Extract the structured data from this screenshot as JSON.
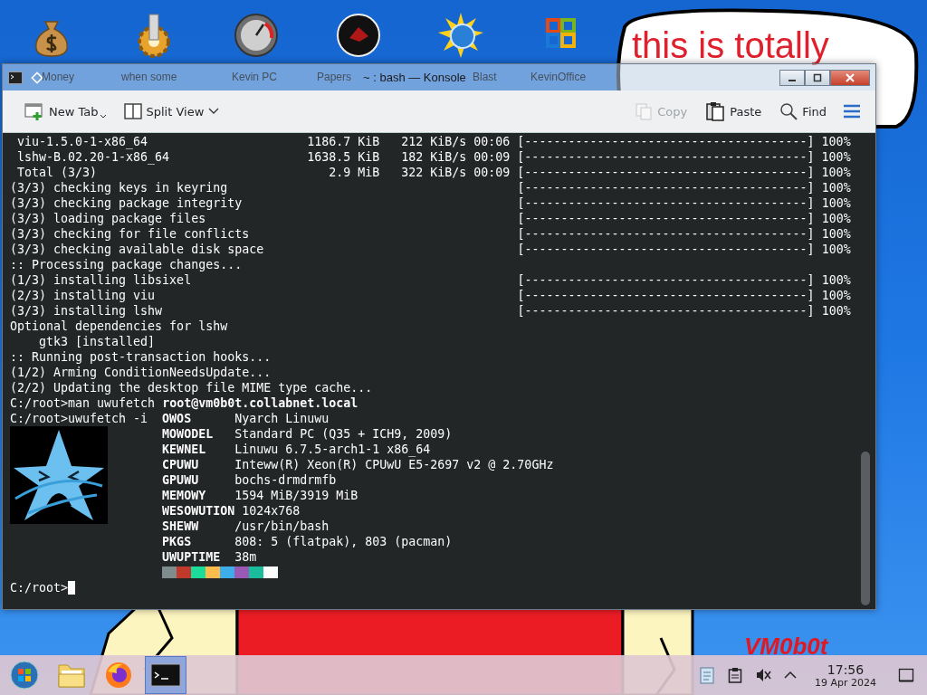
{
  "desktop_icons": [
    {
      "label": "Money",
      "kind": "money"
    },
    {
      "label": "when some",
      "kind": "gear"
    },
    {
      "label": "Kevin PC",
      "kind": "gauge"
    },
    {
      "label": "Papers",
      "kind": "dark"
    },
    {
      "label": "Blast",
      "kind": "sun"
    },
    {
      "label": "KevinOffice",
      "kind": "office"
    }
  ],
  "wallpaper": {
    "bubble_text": "this is totally",
    "corner_text": "VM0b0t"
  },
  "window": {
    "title": "~ : bash — Konsole"
  },
  "toolbar": {
    "left": [
      {
        "label": "New Tab",
        "kind": "newtab"
      },
      {
        "label": "Split View",
        "kind": "split"
      }
    ],
    "right": [
      {
        "label": "Copy",
        "kind": "copy",
        "disabled": true
      },
      {
        "label": "Paste",
        "kind": "paste",
        "disabled": false
      },
      {
        "label": "Find",
        "kind": "find",
        "disabled": false
      }
    ]
  },
  "terminal": {
    "lines": [
      {
        "kind": "download",
        "text": " viu-1.5.0-1-x86_64",
        "stats": "1186.7 KiB   212 KiB/s 00:06",
        "bar": "[---------------------------------------]",
        "percent": "100%"
      },
      {
        "kind": "download",
        "text": " lshw-B.02.20-1-x86_64",
        "stats": "1638.5 KiB   182 KiB/s 00:09",
        "bar": "[---------------------------------------]",
        "percent": "100%"
      },
      {
        "kind": "download",
        "text": " Total (3/3)",
        "stats": "2.9 MiB   322 KiB/s 00:09",
        "bar": "[---------------------------------------]",
        "percent": "100%"
      },
      {
        "kind": "step",
        "text": "(3/3) checking keys in keyring",
        "bar": "[---------------------------------------]",
        "percent": "100%"
      },
      {
        "kind": "step",
        "text": "(3/3) checking package integrity",
        "bar": "[---------------------------------------]",
        "percent": "100%"
      },
      {
        "kind": "step",
        "text": "(3/3) loading package files",
        "bar": "[---------------------------------------]",
        "percent": "100%"
      },
      {
        "kind": "step",
        "text": "(3/3) checking for file conflicts",
        "bar": "[---------------------------------------]",
        "percent": "100%"
      },
      {
        "kind": "step",
        "text": "(3/3) checking available disk space",
        "bar": "[---------------------------------------]",
        "percent": "100%"
      },
      {
        "kind": "text",
        "text": ":: Processing package changes..."
      },
      {
        "kind": "step",
        "text": "(1/3) installing libsixel",
        "bar": "[---------------------------------------]",
        "percent": "100%"
      },
      {
        "kind": "step",
        "text": "(2/3) installing viu",
        "bar": "[---------------------------------------]",
        "percent": "100%"
      },
      {
        "kind": "step",
        "text": "(3/3) installing lshw",
        "bar": "[---------------------------------------]",
        "percent": "100%"
      },
      {
        "kind": "text",
        "text": "Optional dependencies for lshw"
      },
      {
        "kind": "text",
        "text": "    gtk3 [installed]"
      },
      {
        "kind": "text",
        "text": ":: Running post-transaction hooks..."
      },
      {
        "kind": "text",
        "text": "(1/2) Arming ConditionNeedsUpdate..."
      },
      {
        "kind": "text",
        "text": "(2/2) Updating the desktop file MIME type cache..."
      },
      {
        "kind": "text",
        "text": "C:/root>man uwufetch **root@vm0b0t.collabnet.local**"
      }
    ],
    "fetch": {
      "command": "C:/root>uwufetch -i",
      "rows": [
        {
          "key": "OWOS",
          "value": "Nyarch Linuwu"
        },
        {
          "key": "MOWODEL",
          "value": "Standard PC (Q35 + ICH9, 2009)"
        },
        {
          "key": "KEWNEL",
          "value": "Linuwu 6.7.5-arch1-1 x86_64"
        },
        {
          "key": "CPUWU",
          "value": "Inteww(R) Xeon(R) CPUwU E5-2697 v2 @ 2.70GHz"
        },
        {
          "key": "GPUWU",
          "value": "bochs-drmdrmfb"
        },
        {
          "key": "MEMOWY",
          "value": "1594 MiB/3919 MiB"
        },
        {
          "key": "WESOWUTION",
          "value": "1024x768"
        },
        {
          "key": "SHEWW",
          "value": "/usr/bin/bash"
        },
        {
          "key": "PKGS",
          "value": "808: 5 (flatpak), 803 (pacman)"
        },
        {
          "key": "UWUPTIME",
          "value": "38m"
        }
      ],
      "palette": [
        {
          "color": "#7f8c8d"
        },
        {
          "color": "#c0392b"
        },
        {
          "color": "#1cdc9a"
        },
        {
          "color": "#fdbc4b"
        },
        {
          "color": "#3daee9"
        },
        {
          "color": "#9b59b6"
        },
        {
          "color": "#1abc9c"
        },
        {
          "color": "#fcfcfc"
        }
      ]
    },
    "prompt": "C:/root>"
  },
  "taskbar": {
    "apps": [
      {
        "kind": "start",
        "selected": false
      },
      {
        "kind": "files",
        "selected": false
      },
      {
        "kind": "browser",
        "selected": false
      },
      {
        "kind": "terminal",
        "selected": true
      }
    ],
    "clock": {
      "time": "17:56",
      "date": "19 Apr 2024"
    }
  }
}
